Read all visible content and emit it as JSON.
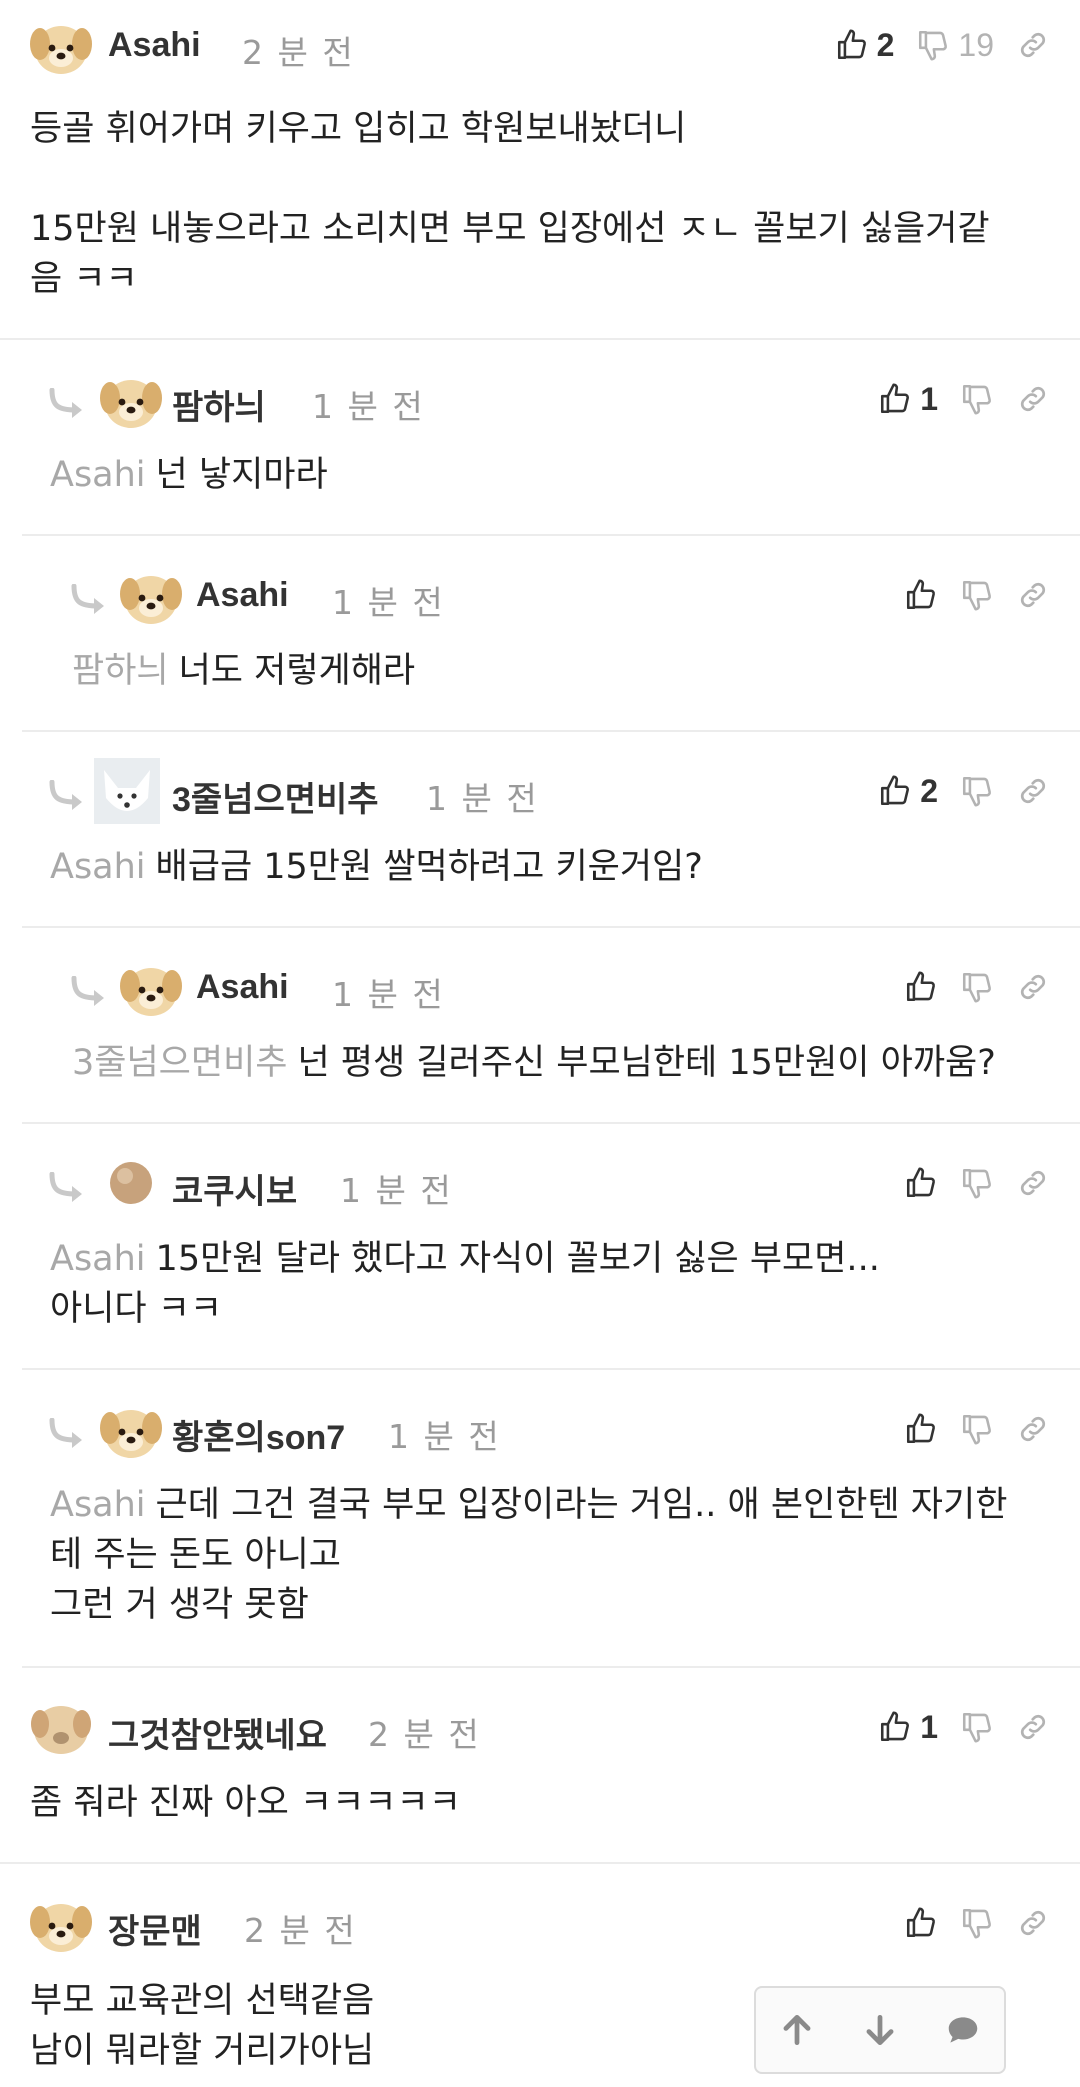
{
  "comments": [
    {
      "nickname": "Asahi",
      "time": "2 분 전",
      "likes": "2",
      "dislikes": "19",
      "mention": "",
      "body": "등골 휘어가며 키우고 입히고 학원보내놨더니\n\n15만원 내놓으라고 소리치면 부모 입장에선 ㅈㄴ 꼴보기 싫을거같\n음 ㅋㅋ",
      "avatar": "puppy"
    },
    {
      "nickname": "팜하늬",
      "time": "1 분 전",
      "likes": "1",
      "dislikes": "",
      "mention": "Asahi",
      "body": "넌 낳지마라",
      "avatar": "puppy"
    },
    {
      "nickname": "Asahi",
      "time": "1 분 전",
      "likes": "",
      "dislikes": "",
      "mention": "팜하늬",
      "body": "너도 저렇게해라",
      "avatar": "puppy"
    },
    {
      "nickname": "3줄넘으면비추",
      "time": "1 분 전",
      "likes": "2",
      "dislikes": "",
      "mention": "Asahi",
      "body": "배급금 15만원 쌀먹하려고 키운거임?",
      "avatar": "fox"
    },
    {
      "nickname": "Asahi",
      "time": "1 분 전",
      "likes": "",
      "dislikes": "",
      "mention": "3줄넘으면비추",
      "body": "넌 평생 길러주신 부모님한테 15만원이 아까움?",
      "avatar": "puppy"
    },
    {
      "nickname": "코쿠시보",
      "time": "1 분 전",
      "likes": "",
      "dislikes": "",
      "mention": "Asahi",
      "body": "15만원 달라 했다고 자식이 꼴보기 싫은 부모면...\n아니다 ㅋㅋ",
      "avatar": "ball"
    },
    {
      "nickname": "황혼의son7",
      "time": "1 분 전",
      "likes": "",
      "dislikes": "",
      "mention": "Asahi",
      "body": "근데 그건 결국 부모 입장이라는 거임.. 애 본인한텐 자기한\n테 주는 돈도 아니고\n그런 거 생각 못함",
      "avatar": "puppy"
    },
    {
      "nickname": "그것참안됐네요",
      "time": "2 분 전",
      "likes": "1",
      "dislikes": "",
      "mention": "",
      "body": "좀 줘라 진짜 아오 ㅋㅋㅋㅋㅋ",
      "avatar": "blur"
    },
    {
      "nickname": "장문맨",
      "time": "2 분 전",
      "likes": "",
      "dislikes": "",
      "mention": "",
      "body": "부모 교육관의 선택같음\n남이 뭐라할 거리가아님",
      "avatar": "puppy"
    }
  ],
  "icons": {
    "like": "thumbs-up-icon",
    "dislike": "thumbs-down-icon",
    "link": "link-icon",
    "reply": "reply-arrow-icon",
    "scroll_up": "arrow-up-icon",
    "scroll_down": "arrow-down-icon",
    "comment": "comment-icon"
  },
  "colors": {
    "mention": "#a8a8a8",
    "time": "#9a9a9a",
    "divider": "#ececec",
    "icon": "#333333",
    "icon_muted": "#b3b3b3"
  }
}
